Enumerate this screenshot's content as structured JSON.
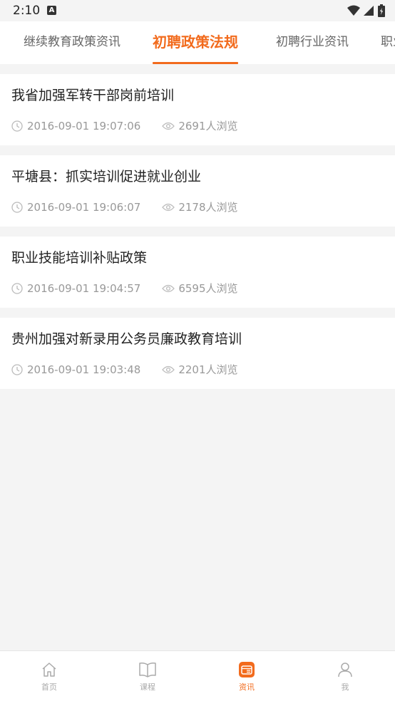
{
  "status_bar": {
    "time": "2:10"
  },
  "tabs": [
    {
      "label": "继续教育政策资讯",
      "active": false
    },
    {
      "label": "初聘政策法规",
      "active": true
    },
    {
      "label": "初聘行业资讯",
      "active": false
    },
    {
      "label": "职业",
      "active": false
    }
  ],
  "news": [
    {
      "title": "我省加强军转干部岗前培训",
      "date": "2016-09-01 19:07:06",
      "views": "2691人浏览"
    },
    {
      "title": "平塘县：抓实培训促进就业创业",
      "date": "2016-09-01 19:06:07",
      "views": "2178人浏览"
    },
    {
      "title": "职业技能培训补贴政策",
      "date": "2016-09-01 19:04:57",
      "views": "6595人浏览"
    },
    {
      "title": "贵州加强对新录用公务员廉政教育培训",
      "date": "2016-09-01 19:03:48",
      "views": "2201人浏览"
    }
  ],
  "bottom_nav": [
    {
      "label": "首页",
      "icon": "home-icon",
      "active": false
    },
    {
      "label": "课程",
      "icon": "book-icon",
      "active": false
    },
    {
      "label": "资讯",
      "icon": "news-icon",
      "active": true
    },
    {
      "label": "我",
      "icon": "user-icon",
      "active": false
    }
  ],
  "colors": {
    "accent": "#f26b1d",
    "muted": "#999999",
    "background": "#f4f4f4"
  }
}
